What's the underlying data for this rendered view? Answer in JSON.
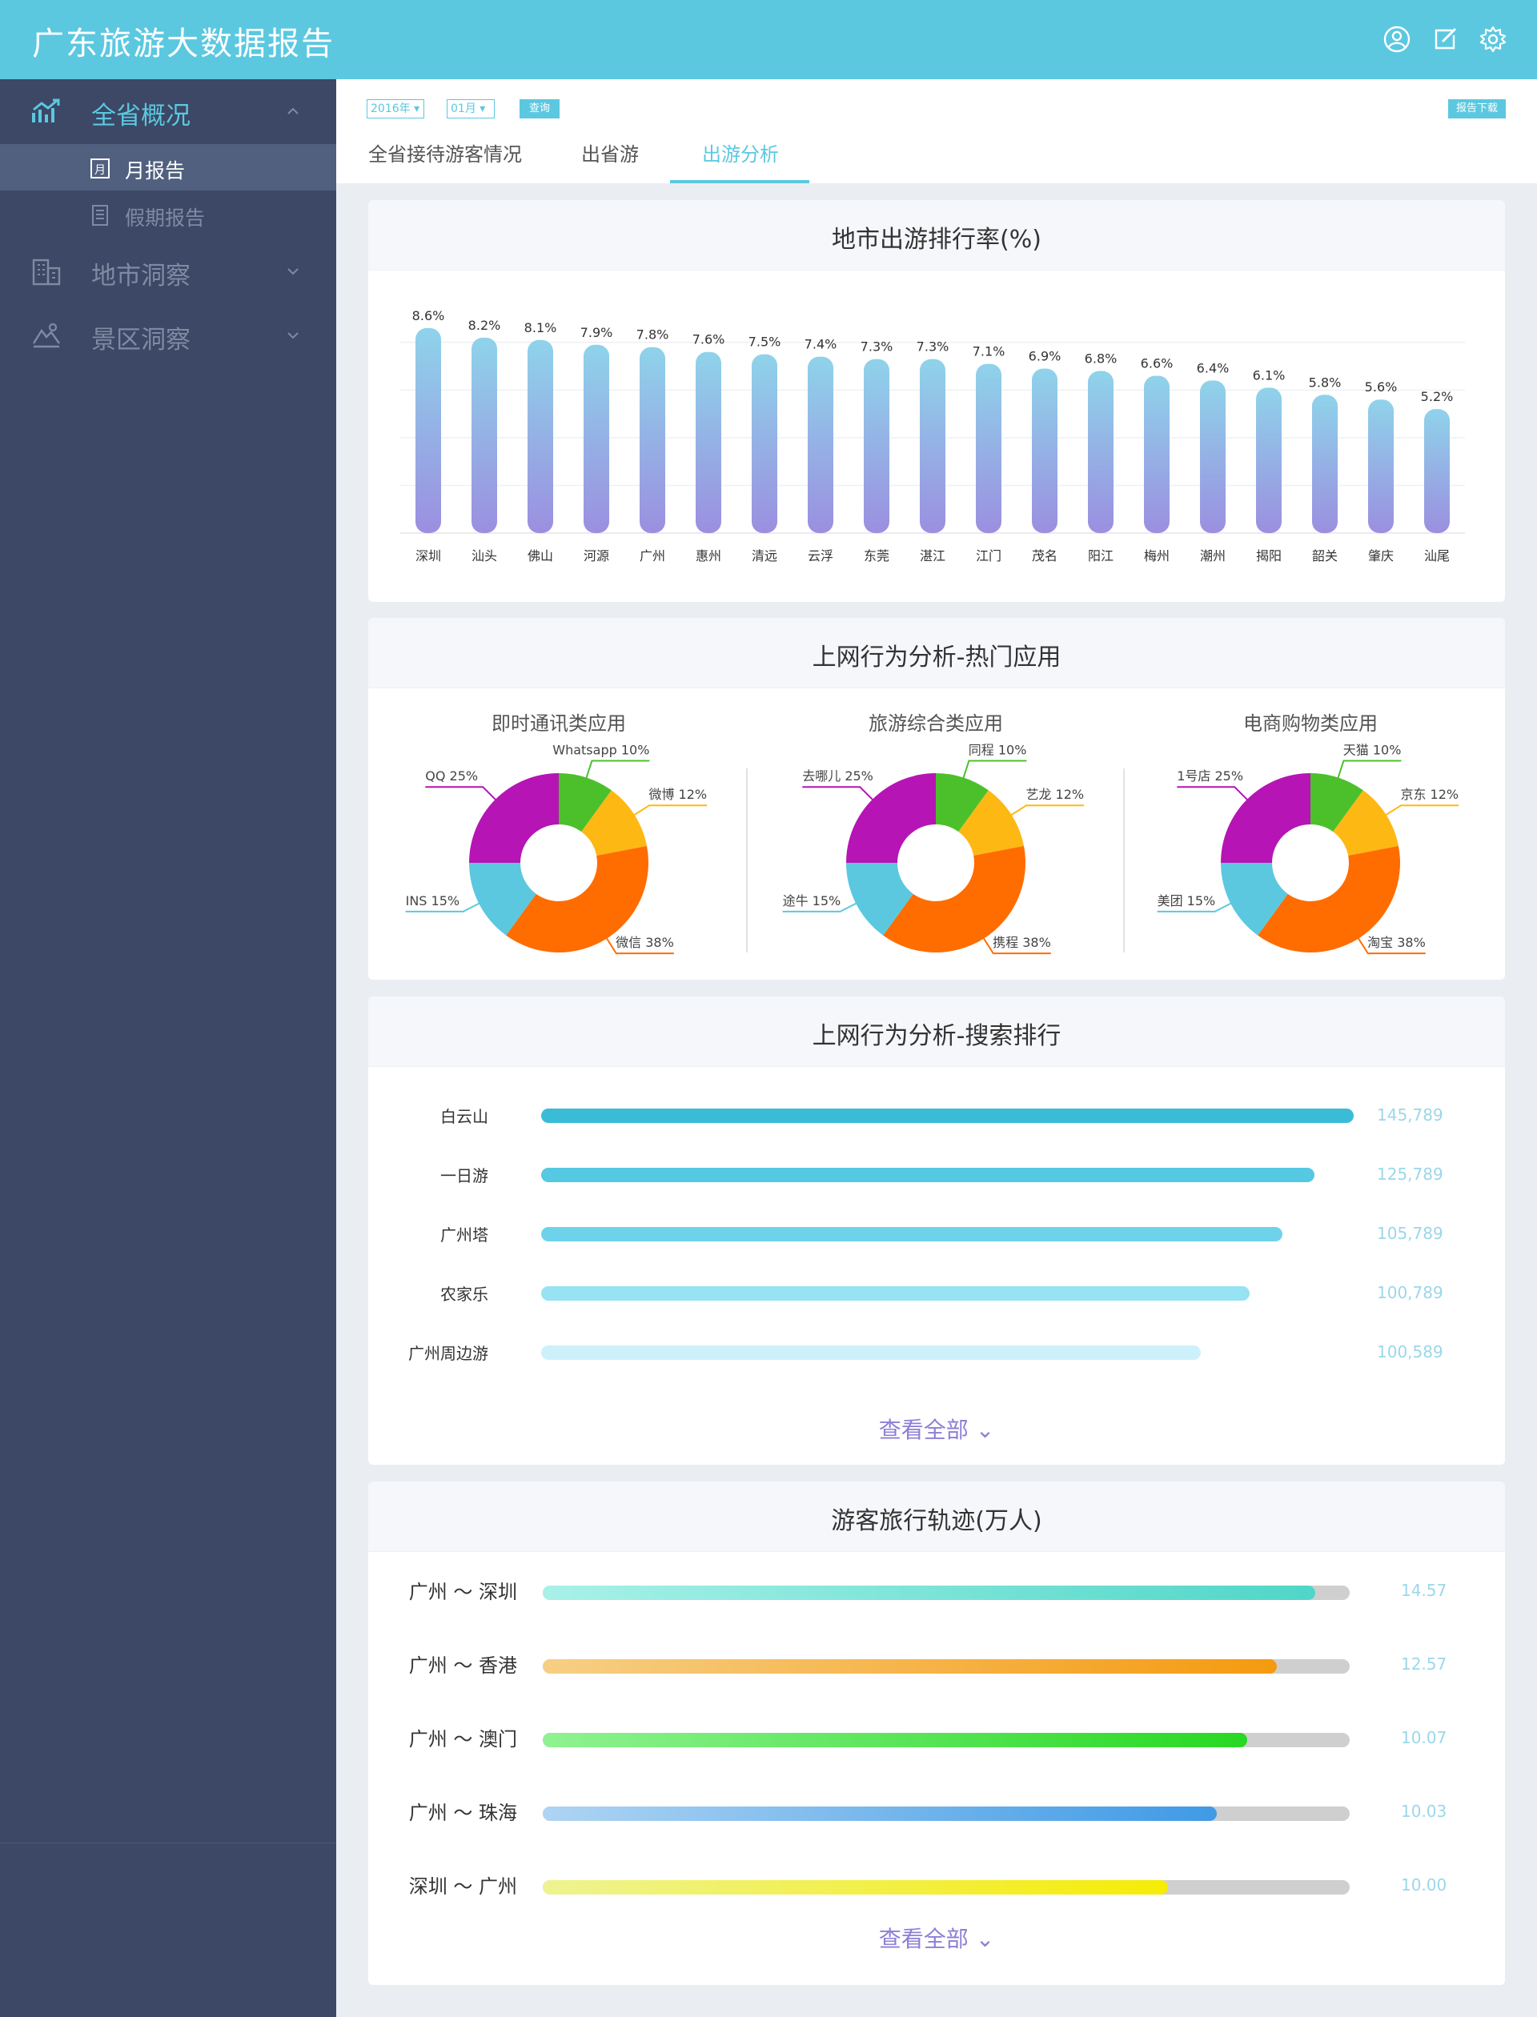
{
  "header": {
    "title": "广东旅游大数据报告",
    "icons": [
      "user-icon",
      "edit-icon",
      "gear-icon"
    ]
  },
  "sidebar": {
    "groups": [
      {
        "label": "全省概况",
        "icon": "trend-chart-icon",
        "expanded": true
      },
      {
        "label": "地市洞察",
        "icon": "building-icon",
        "expanded": false
      },
      {
        "label": "景区洞察",
        "icon": "landscape-icon",
        "expanded": false
      }
    ],
    "subitems": [
      {
        "label": "月报告",
        "icon": "calendar-icon",
        "active": true
      },
      {
        "label": "假期报告",
        "icon": "document-icon",
        "active": false
      }
    ]
  },
  "filters": {
    "year": "2016年",
    "month": "01月",
    "query": "查询",
    "download": "报告下载"
  },
  "tabs": [
    {
      "label": "全省接待游客情况",
      "active": false
    },
    {
      "label": "出省游",
      "active": false
    },
    {
      "label": "出游分析",
      "active": true
    }
  ],
  "ranking": {
    "title": "地市出游排行率(%)",
    "chart_data": {
      "type": "bar",
      "categories": [
        "深圳",
        "汕头",
        "佛山",
        "河源",
        "广州",
        "惠州",
        "清远",
        "云浮",
        "东莞",
        "湛江",
        "江门",
        "茂名",
        "阳江",
        "梅州",
        "潮州",
        "揭阳",
        "韶关",
        "肇庆",
        "汕尾"
      ],
      "values": [
        8.6,
        8.2,
        8.1,
        7.9,
        7.8,
        7.6,
        7.5,
        7.4,
        7.3,
        7.3,
        7.1,
        6.9,
        6.8,
        6.6,
        6.4,
        6.1,
        5.8,
        5.6,
        5.2
      ],
      "value_labels": [
        "8.6%",
        "8.2%",
        "8.1%",
        "7.9%",
        "7.8%",
        "7.6%",
        "7.5%",
        "7.4%",
        "7.3%",
        "7.3%",
        "7.1%",
        "6.9%",
        "6.8%",
        "6.6%",
        "6.4%",
        "6.1%",
        "5.8%",
        "5.6%",
        "5.2%"
      ],
      "title": "地市出游排行率(%)",
      "xlabel": "",
      "ylabel": "",
      "ylim": [
        0,
        9
      ],
      "grid": true,
      "colors": {
        "top": "#8fd3ea",
        "bottom": "#9b8fe0"
      }
    }
  },
  "apps": {
    "title": "上网行为分析-热门应用",
    "chart_data": [
      {
        "type": "pie",
        "title": "即时通讯类应用",
        "categories": [
          "Whatsapp",
          "微博",
          "微信",
          "INS",
          "QQ"
        ],
        "values": [
          10,
          12,
          38,
          15,
          25
        ],
        "labels": [
          "Whatsapp 10%",
          "微博 12%",
          "微信 38%",
          "INS 15%",
          "QQ 25%"
        ],
        "colors": [
          "#4cc02a",
          "#fdb813",
          "#ff6c00",
          "#5bc8e0",
          "#b614b4"
        ]
      },
      {
        "type": "pie",
        "title": "旅游综合类应用",
        "categories": [
          "同程",
          "艺龙",
          "携程",
          "途牛",
          "去哪儿"
        ],
        "values": [
          10,
          12,
          38,
          15,
          25
        ],
        "labels": [
          "同程 10%",
          "艺龙 12%",
          "携程 38%",
          "途牛 15%",
          "去哪儿 25%"
        ],
        "colors": [
          "#4cc02a",
          "#fdb813",
          "#ff6c00",
          "#5bc8e0",
          "#b614b4"
        ]
      },
      {
        "type": "pie",
        "title": "电商购物类应用",
        "categories": [
          "天猫",
          "京东",
          "淘宝",
          "美团",
          "1号店"
        ],
        "values": [
          10,
          12,
          38,
          15,
          25
        ],
        "labels": [
          "天猫 10%",
          "京东 12%",
          "淘宝 38%",
          "美团 15%",
          "1号店 25%"
        ],
        "colors": [
          "#4cc02a",
          "#fdb813",
          "#ff6c00",
          "#5bc8e0",
          "#b614b4"
        ]
      }
    ]
  },
  "search": {
    "title": "上网行为分析-搜索排行",
    "chart_data": {
      "type": "bar",
      "categories": [
        "白云山",
        "一日游",
        "广州塔",
        "农家乐",
        "广州周边游"
      ],
      "values": [
        145789,
        125789,
        105789,
        100789,
        100589
      ],
      "value_labels": [
        "145,789",
        "125,789",
        "105,789",
        "100,789",
        "100,589"
      ],
      "colors": [
        "#3bbcd6",
        "#55c8e2",
        "#6ed3ea",
        "#97e2f3",
        "#cdf1fa"
      ]
    },
    "more": "查看全部"
  },
  "routes": {
    "title": "游客旅行轨迹(万人)",
    "items": [
      {
        "label": "广州 ～ 深圳",
        "value": 14.57,
        "display": "14.57",
        "fill": 0.957,
        "from": "#a8f1e8",
        "to": "#4fd6c8"
      },
      {
        "label": "广州 ～ 香港",
        "value": 12.57,
        "display": "12.57",
        "fill": 0.91,
        "from": "#f6cf85",
        "to": "#f59a0f"
      },
      {
        "label": "广州 ～ 澳门",
        "value": 10.07,
        "display": "10.07",
        "fill": 0.873,
        "from": "#8ff291",
        "to": "#27d822"
      },
      {
        "label": "广州 ～ 珠海",
        "value": 10.03,
        "display": "10.03",
        "fill": 0.835,
        "from": "#aed4f3",
        "to": "#3f9ae6"
      },
      {
        "label": "深圳 ～ 广州",
        "value": 10.0,
        "display": "10.00",
        "fill": 0.775,
        "from": "#eef392",
        "to": "#f6ec06"
      }
    ],
    "more": "查看全部"
  }
}
